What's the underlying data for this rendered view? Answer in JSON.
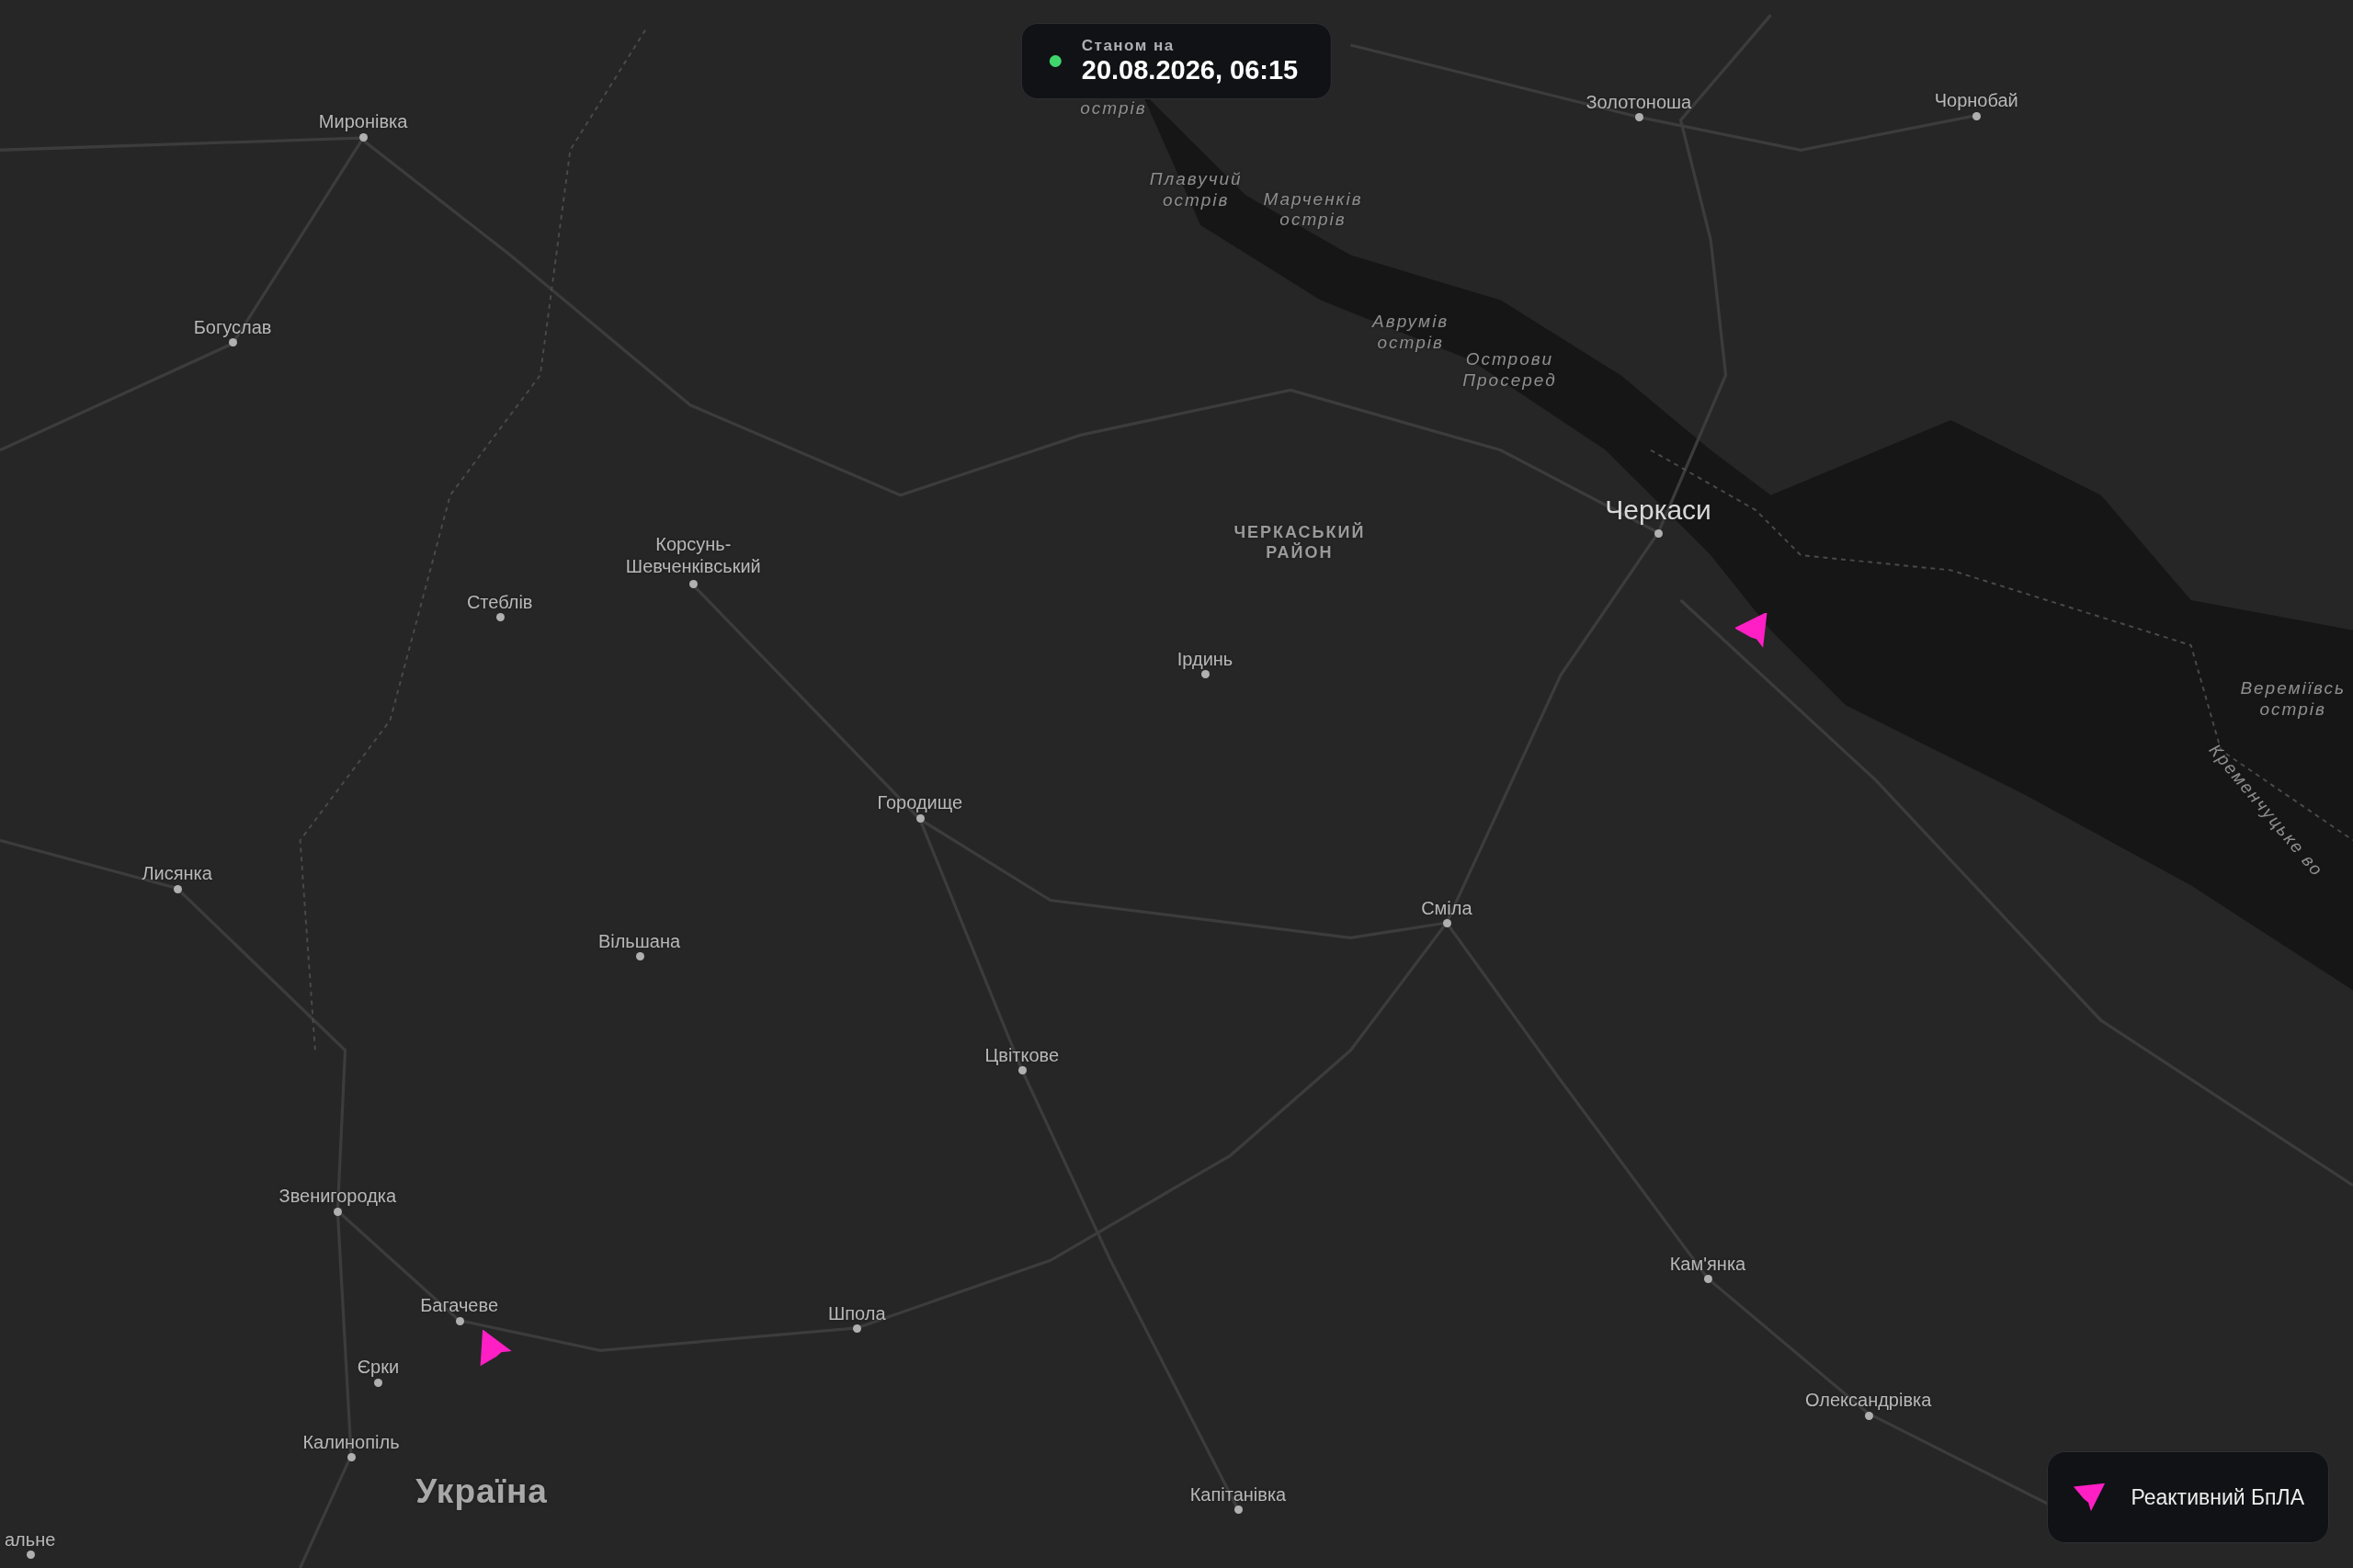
{
  "status": {
    "label": "Станом на",
    "timestamp": "20.08.2026, 06:15"
  },
  "places": [
    {
      "kind": "island",
      "name": "острів"
    },
    {
      "kind": "city",
      "name": "Миронівка"
    },
    {
      "kind": "city",
      "name": "Золотоноша"
    },
    {
      "kind": "city",
      "name": "Чорнобай"
    },
    {
      "kind": "island",
      "name": "Плавучий\nострів"
    },
    {
      "kind": "island",
      "name": "Марченків\nострів"
    },
    {
      "kind": "city",
      "name": "Богуслав"
    },
    {
      "kind": "island",
      "name": "Аврумів\nострів"
    },
    {
      "kind": "island",
      "name": "Острови\nПросеред"
    },
    {
      "kind": "capital",
      "name": "Черкаси"
    },
    {
      "kind": "region",
      "name": "ЧЕРКАСЬКИЙ\nРАЙОН"
    },
    {
      "kind": "city",
      "name": "Корсунь-\nШевченківський"
    },
    {
      "kind": "city",
      "name": "Стеблів"
    },
    {
      "kind": "city",
      "name": "Ірдинь"
    },
    {
      "kind": "island",
      "name": "Веремiївсь\nострів"
    },
    {
      "kind": "water",
      "name": "Кременчуцьке во"
    },
    {
      "kind": "city",
      "name": "Городище"
    },
    {
      "kind": "city",
      "name": "Лисянка"
    },
    {
      "kind": "city",
      "name": "Сміла"
    },
    {
      "kind": "city",
      "name": "Вільшана"
    },
    {
      "kind": "city",
      "name": "Цвіткове"
    },
    {
      "kind": "city",
      "name": "Звенигородка"
    },
    {
      "kind": "city",
      "name": "Кам'янка"
    },
    {
      "kind": "city",
      "name": "Багачеве"
    },
    {
      "kind": "city",
      "name": "Шпола"
    },
    {
      "kind": "city",
      "name": "Єрки"
    },
    {
      "kind": "city",
      "name": "Олександрівка"
    },
    {
      "kind": "city",
      "name": "Калинопіль"
    },
    {
      "kind": "country",
      "name": "Україна"
    },
    {
      "kind": "city",
      "name": "Капітанівка"
    },
    {
      "kind": "city",
      "name": "альне"
    }
  ],
  "markers": [
    {
      "kind": "jet_drone"
    },
    {
      "kind": "jet_drone"
    }
  ],
  "legend": [
    {
      "kind": "jet_drone",
      "label": "Реактивний БпЛА"
    }
  ]
}
